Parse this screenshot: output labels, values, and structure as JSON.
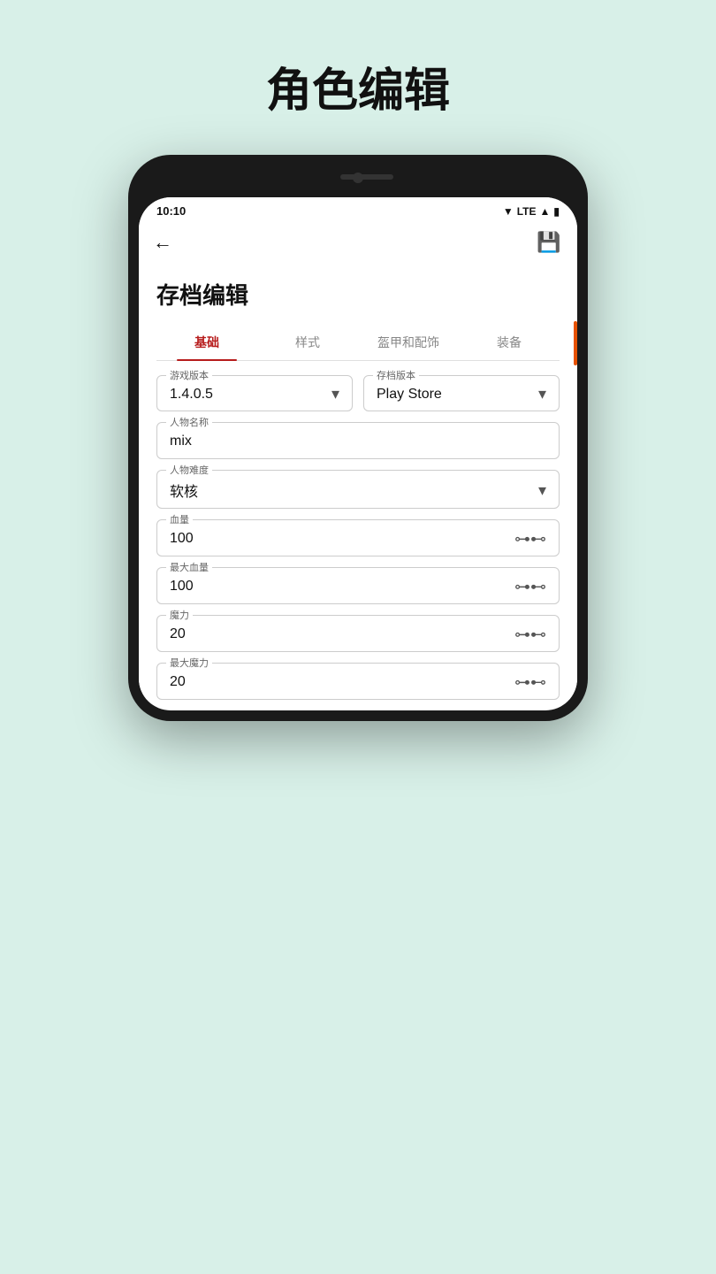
{
  "page": {
    "title": "角色编辑",
    "background": "#d8f0e8"
  },
  "status_bar": {
    "time": "10:10",
    "signal": "LTE"
  },
  "app_bar": {
    "back_label": "←",
    "save_label": "💾"
  },
  "content": {
    "section_title": "存档编辑",
    "tabs": [
      {
        "id": "basic",
        "label": "基础",
        "active": true
      },
      {
        "id": "style",
        "label": "样式",
        "active": false
      },
      {
        "id": "armor",
        "label": "盔甲和配饰",
        "active": false
      },
      {
        "id": "equip",
        "label": "装备",
        "active": false
      }
    ],
    "fields": {
      "game_version": {
        "label": "游戏版本",
        "value": "1.4.0.5",
        "type": "dropdown"
      },
      "save_version": {
        "label": "存档版本",
        "value": "Play Store",
        "type": "dropdown"
      },
      "character_name": {
        "label": "人物名称",
        "value": "mix",
        "type": "text"
      },
      "character_difficulty": {
        "label": "人物难度",
        "value": "软核",
        "type": "dropdown"
      },
      "hp": {
        "label": "血量",
        "value": "100",
        "type": "slider"
      },
      "max_hp": {
        "label": "最大血量",
        "value": "100",
        "type": "slider"
      },
      "mana": {
        "label": "魔力",
        "value": "20",
        "type": "slider"
      },
      "max_mana": {
        "label": "最大魔力",
        "value": "20",
        "type": "slider"
      }
    }
  }
}
